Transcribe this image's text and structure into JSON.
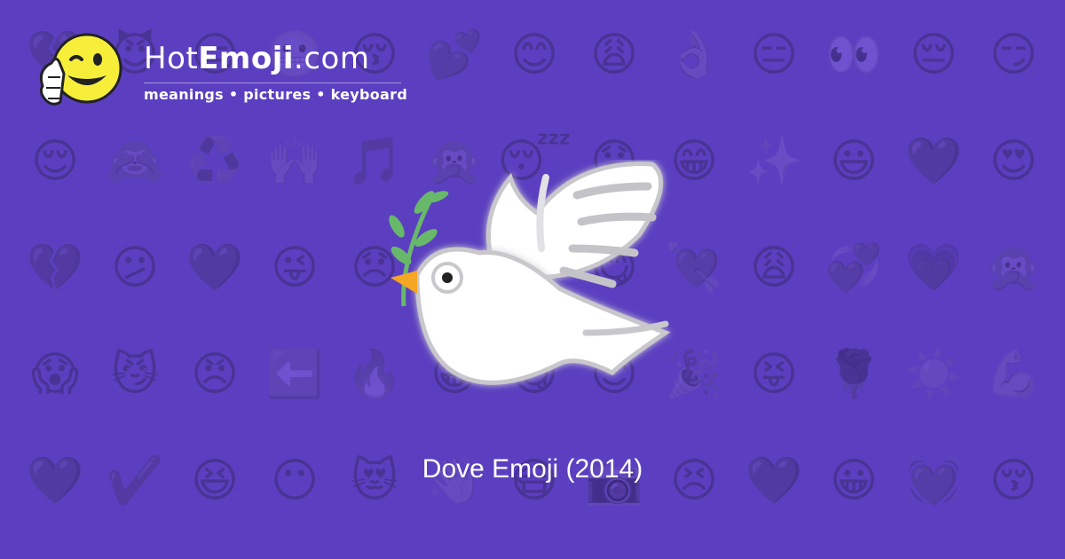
{
  "site": {
    "name_prefix": "Hot",
    "name_bold": "Emoji",
    "name_suffix": ".com",
    "tagline": "meanings • pictures • keyboard",
    "logo_icon": "winking-thumbs-up-face-icon"
  },
  "hero": {
    "emoji_icon": "dove-with-olive-branch-icon",
    "caption": "Dove Emoji (2014)"
  },
  "colors": {
    "background": "#5b3fc0",
    "pattern": "#4a31a3",
    "text": "#ffffff",
    "logo_face": "#f7ee3a"
  },
  "background_pattern": [
    "💔",
    "😈",
    "😑",
    "😬",
    "😚",
    "💕",
    "😊",
    "😩",
    "👌",
    "😑",
    "👀",
    "😔",
    "😏",
    "😌",
    "🙈",
    "♻️",
    "🙌",
    "🎵",
    "🙊",
    "😴",
    "😞",
    "😁",
    "✨",
    "😃",
    "💜",
    "😍",
    "💔",
    "😕",
    "💜",
    "😜",
    "😞",
    "😅",
    "🤣",
    "😋",
    "💘",
    "😩",
    "💞",
    "💗",
    "🙊",
    "😱",
    "😼",
    "😠",
    "⬅️",
    "🔥",
    "😁",
    "😋",
    "😊",
    "🎉",
    "😝",
    "🌹",
    "☀️",
    "💪",
    "💜",
    "✔️",
    "😆",
    "😶",
    "😻",
    "👋",
    "😷",
    "📷",
    "😣",
    "💜",
    "😀",
    "💓",
    "😚"
  ]
}
